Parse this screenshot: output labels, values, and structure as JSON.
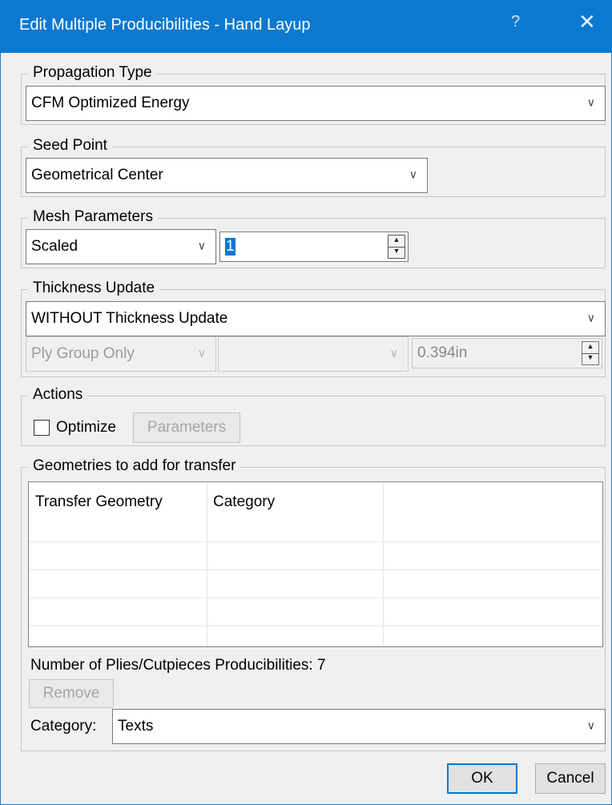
{
  "window": {
    "title": "Edit Multiple Producibilities - Hand Layup",
    "help_glyph": "?",
    "close_glyph": "✕"
  },
  "propagation": {
    "legend": "Propagation Type",
    "selected": "CFM Optimized Energy"
  },
  "seed": {
    "legend": "Seed Point",
    "selected": "Geometrical Center"
  },
  "mesh": {
    "legend": "Mesh Parameters",
    "mode": "Scaled",
    "value": "1"
  },
  "thickness": {
    "legend": "Thickness Update",
    "selected": "WITHOUT Thickness Update",
    "scope": "Ply Group Only",
    "secondary": "",
    "value": "0.394in"
  },
  "actions": {
    "legend": "Actions",
    "optimize_label": "Optimize",
    "optimize_checked": false,
    "parameters_label": "Parameters"
  },
  "geometries": {
    "legend": "Geometries to add for transfer",
    "columns": [
      "Transfer Geometry",
      "Category",
      ""
    ],
    "rows": [],
    "count_text": "Number of Plies/Cutpieces Producibilities: 7",
    "remove_label": "Remove",
    "category_label": "Category:",
    "category_selected": "Texts"
  },
  "footer": {
    "ok_label": "OK",
    "cancel_label": "Cancel"
  }
}
